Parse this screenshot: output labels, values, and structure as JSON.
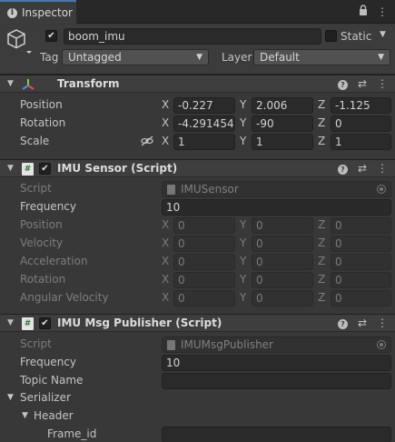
{
  "tab": {
    "label": "Inspector"
  },
  "gameobject": {
    "active": true,
    "name": "boom_imu",
    "static_label": "Static",
    "static_checked": false,
    "tag_label": "Tag",
    "tag_value": "Untagged",
    "layer_label": "Layer",
    "layer_value": "Default"
  },
  "transform": {
    "title": "Transform",
    "rows": [
      {
        "label": "Position",
        "x": "-0.227",
        "y": "2.006",
        "z": "-1.125"
      },
      {
        "label": "Rotation",
        "x": "-4.291454",
        "y": "-90",
        "z": "0"
      },
      {
        "label": "Scale",
        "x": "1",
        "y": "1",
        "z": "1"
      }
    ]
  },
  "axes": {
    "x": "X",
    "y": "Y",
    "z": "Z"
  },
  "imu_sensor": {
    "enabled": true,
    "title": "IMU Sensor (Script)",
    "script_label": "Script",
    "script_value": "IMUSensor",
    "frequency_label": "Frequency",
    "frequency_value": "10",
    "vectors": [
      {
        "label": "Position",
        "x": "0",
        "y": "0",
        "z": "0"
      },
      {
        "label": "Velocity",
        "x": "0",
        "y": "0",
        "z": "0"
      },
      {
        "label": "Acceleration",
        "x": "0",
        "y": "0",
        "z": "0"
      },
      {
        "label": "Rotation",
        "x": "0",
        "y": "0",
        "z": "0"
      },
      {
        "label": "Angular Velocity",
        "x": "0",
        "y": "0",
        "z": "0"
      }
    ]
  },
  "imu_publisher": {
    "enabled": true,
    "title": "IMU Msg Publisher (Script)",
    "script_label": "Script",
    "script_value": "IMUMsgPublisher",
    "frequency_label": "Frequency",
    "frequency_value": "10",
    "topic_label": "Topic Name",
    "topic_value": "",
    "serializer_label": "Serializer",
    "header_label": "Header",
    "frame_id_label": "Frame_id",
    "frame_id_value": ""
  }
}
